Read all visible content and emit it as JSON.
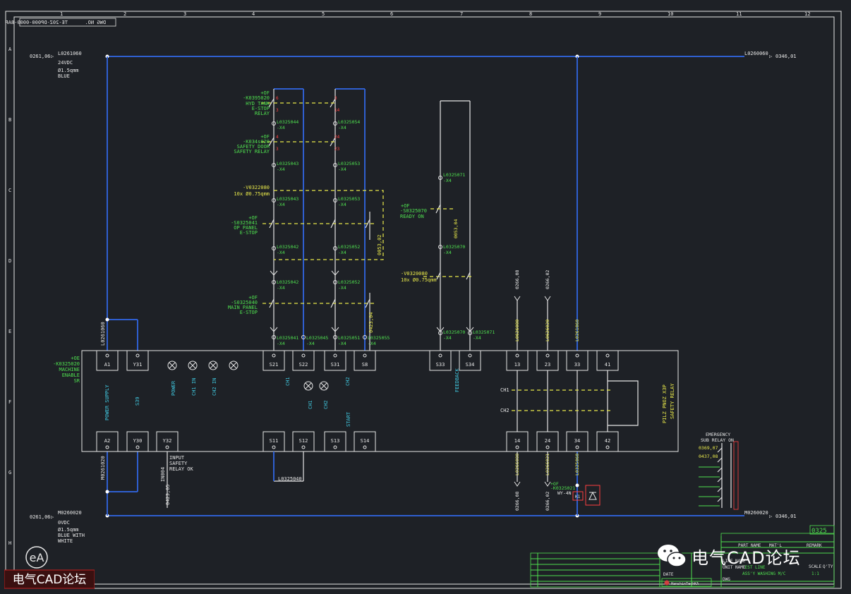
{
  "header": {
    "dwg_no_label": "DWG NO.",
    "dwg_no_value": "TE-20Z-DP000-0000-8AP"
  },
  "border_columns": [
    "1",
    "2",
    "3",
    "4",
    "5",
    "6",
    "7",
    "8",
    "9",
    "10",
    "11",
    "12"
  ],
  "border_rows": [
    "A",
    "B",
    "C",
    "D",
    "E",
    "F",
    "G",
    "H"
  ],
  "rails": {
    "top_left_ref": "0261,06",
    "top_wire": "L0261060",
    "top_voltage": "24VDC",
    "top_size": "Ø1.5qmm",
    "top_color": "BLUE",
    "top_right_wire": "L0260060",
    "top_right_ref": "0346,01",
    "bottom_left_ref": "0261,06",
    "bottom_wire": "M0260020",
    "bottom_voltage": "0VDC",
    "bottom_size": "Ø1.5qmm",
    "bottom_color": "BLUE WITH",
    "bottom_color2": "WHITE",
    "bottom_right_wire": "M0260020",
    "bottom_right_ref": "0346,01"
  },
  "contacts": {
    "k1_loc": "+OF",
    "k1_tag": "-K0395020",
    "k1_l1": "HYD TANK",
    "k1_l2": "E-STOP",
    "k1_l3": "RELAY",
    "k2_loc": "+OF",
    "k2_tag": "-K034s020",
    "k2_l1": "SAFETY DOOR",
    "k2_l2": "SAFETY RELAY",
    "cable_tag": "-V0322080",
    "cable_spec": "10x Ø0.75qmm",
    "s1_loc": "+OF",
    "s1_tag": "-S0325041",
    "s1_l1": "OP PANEL",
    "s1_l2": "E-STOP",
    "s2_loc": "+OF",
    "s2_tag": "-S0325040",
    "s2_l1": "MAIN PANEL",
    "s2_l2": "E-STOP",
    "ready_loc": "+OF",
    "ready_tag": "-S0325070",
    "ready_label": "READY ON",
    "cable2_tag": "-V0320080",
    "cable2_spec": "10x Ø0.75qmm"
  },
  "wires": {
    "w044": "L0325044",
    "w054": "L0325054",
    "w043": "L0325043",
    "w053": "L0325053",
    "w043b": "L0325043",
    "w053b": "L0325053",
    "w042": "L0325042",
    "w052": "L0325052",
    "w042b": "L0325042",
    "w052b": "L0325052",
    "w041": "L0325041",
    "w045": "L0325045",
    "w051": "L0325051",
    "w055": "L0325055",
    "w071": "L0325071",
    "w070": "L0325070",
    "w070b": "L0325070",
    "w071b": "L0325071",
    "x4": "-X4",
    "vert_a": "0053,02",
    "vert_b": "0053,04",
    "vert_c": "0423,04",
    "l060": "L0261060",
    "m020": "M0261020",
    "l040": "L0325040",
    "l080": "L0626080",
    "l020": "L0626020",
    "l060b": "L0261060",
    "ref1": "0266,08",
    "ref2": "0266,02",
    "bot1": "L0266080",
    "bot2": "L0266021",
    "bot3": "L0325060",
    "botref1": "0266,08",
    "botref2": "0266,02",
    "in04": "IN004",
    "in04ref": "0423,05"
  },
  "relay": {
    "loc": "+OE",
    "tag": "-K0325020",
    "l1": "MACHINE",
    "l2": "ENABLE",
    "l3": "SR",
    "top_terms": [
      "A1",
      "Y31",
      "S21",
      "S22",
      "S31",
      "S8",
      "S33",
      "S34",
      "13",
      "23",
      "33",
      "41"
    ],
    "bot_terms": [
      "A2",
      "Y30",
      "Y32",
      "S11",
      "S12",
      "S13",
      "S14",
      "14",
      "24",
      "34",
      "42"
    ],
    "power_supply": "POWER SUPPLY",
    "s39": "S39",
    "lamps": [
      "POWER",
      "CH1 IN",
      "CH2 IN"
    ],
    "ch1": "CH1",
    "ch2": "CH2",
    "ch1_lamp": "CH1",
    "ch2_lamp": "CH2",
    "start": "START",
    "feedback": "FEEDBACK",
    "ch1_out": "CH1",
    "ch2_out": "CH2",
    "type_l1": "PILZ PNOZ X3P",
    "type_l2": "SAFETY RELAY",
    "input_l1": "INPUT",
    "input_l2": "SAFETY",
    "input_l3": "RELAY OK",
    "k1_loc": "+OF",
    "k1_tag": "-K0325021",
    "k1_label": "WY-4N",
    "k1": "K1"
  },
  "sub_relay": {
    "l1": "EMERGENCY",
    "l2": "SUB RELAY ON",
    "ref1": "0369,07",
    "ref2": "0437,08"
  },
  "title_block": {
    "sheet_no": "0325",
    "part_name": "PART NAME",
    "matl": "MAT'L",
    "remark": "REMARK",
    "line_name": "LINE NAME",
    "line_value": "TEST LINE",
    "unit_name": "UNIT NAME",
    "unit_value": "ASS'Y WASHING M/C",
    "scale": "SCALE",
    "qty": "Q'TY",
    "scale_v": "1:1",
    "date": "DATE",
    "company": "HanshinTechKA",
    "dwg": "DWG"
  },
  "watermark": {
    "logo": "eA",
    "text": "电气CAD论坛",
    "wechat_text": "电气CAD论坛"
  }
}
